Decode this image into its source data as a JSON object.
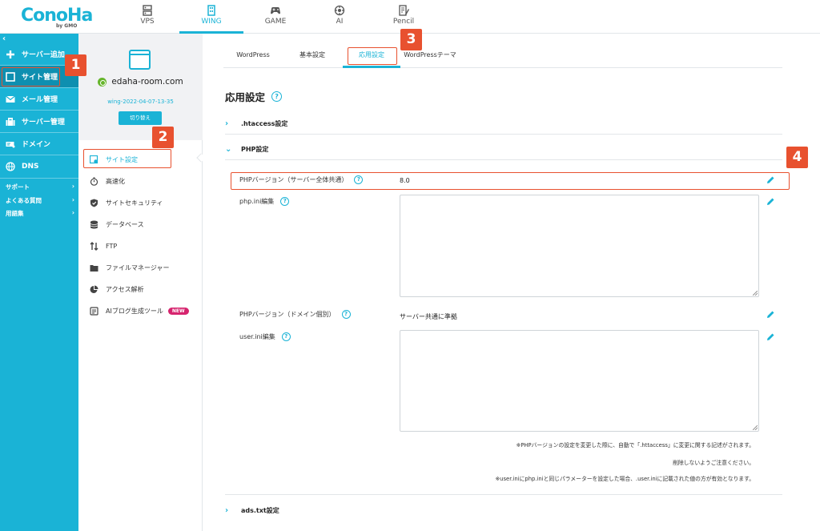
{
  "logo": {
    "main": "ConoHa",
    "sub": "by GMO"
  },
  "top_nav": [
    {
      "label": "VPS",
      "icon": "server-icon"
    },
    {
      "label": "WING",
      "icon": "building-icon",
      "active": true
    },
    {
      "label": "GAME",
      "icon": "gamepad-icon"
    },
    {
      "label": "AI",
      "icon": "ai-icon"
    },
    {
      "label": "Pencil",
      "icon": "pencil-doc-icon"
    }
  ],
  "sidebar": {
    "collapse": "‹",
    "items": [
      {
        "label": "サーバー追加",
        "icon": "plus-icon"
      },
      {
        "label": "サイト管理",
        "icon": "site-icon",
        "active": true
      },
      {
        "label": "メール管理",
        "icon": "mail-icon"
      },
      {
        "label": "サーバー管理",
        "icon": "server-manage-icon"
      },
      {
        "label": "ドメイン",
        "icon": "domain-icon"
      },
      {
        "label": "DNS",
        "icon": "globe-icon"
      }
    ],
    "links": [
      {
        "label": "サポート",
        "arrow": "›"
      },
      {
        "label": "よくある質問",
        "arrow": "›"
      },
      {
        "label": "用語集",
        "arrow": "›"
      }
    ]
  },
  "site": {
    "name": "edaha-room.com",
    "id": "wing-2022-04-07-13-35",
    "switch_label": "切り替え",
    "menu": [
      {
        "label": "サイト設定",
        "icon": "site-settings-icon",
        "active": true
      },
      {
        "label": "高速化",
        "icon": "stopwatch-icon"
      },
      {
        "label": "サイトセキュリティ",
        "icon": "shield-icon"
      },
      {
        "label": "データベース",
        "icon": "database-icon"
      },
      {
        "label": "FTP",
        "icon": "transfer-icon"
      },
      {
        "label": "ファイルマネージャー",
        "icon": "folder-icon"
      },
      {
        "label": "アクセス解析",
        "icon": "pie-chart-icon"
      },
      {
        "label": "AIブログ生成ツール",
        "icon": "ai-blog-icon",
        "badge": "NEW"
      }
    ]
  },
  "tabs": [
    {
      "label": "WordPress"
    },
    {
      "label": "基本設定"
    },
    {
      "label": "応用設定",
      "active": true
    },
    {
      "label": "WordPressテーマ"
    }
  ],
  "heading": "応用設定",
  "help_glyph": "?",
  "sections": {
    "htaccess": ".htaccess設定",
    "php": "PHP設定",
    "ads": "ads.txt設定"
  },
  "php": {
    "version_label": "PHPバージョン（サーバー全体共通）",
    "version_value": "8.0",
    "ini_label": "php.ini編集",
    "ini_value": "",
    "domain_version_label": "PHPバージョン（ドメイン個別）",
    "domain_version_value": "サーバー共通に準拠",
    "userini_label": "user.ini編集",
    "userini_value": "",
    "notes": [
      "※PHPバージョンの設定を変更した際に、自動で「.httaccess」に変更に関する記述がされます。",
      "削除しないようご注意ください。",
      "※user.iniにphp.iniと同じパラメーターを設定した場合、.user.iniに記載された値の方が有効となります。"
    ]
  },
  "annotations": [
    "1",
    "2",
    "3",
    "4"
  ],
  "colors": {
    "accent": "#1ab3d6",
    "sidebar_active": "#0e8fb0",
    "highlight": "#e8512f",
    "new_badge": "#d6246e"
  }
}
